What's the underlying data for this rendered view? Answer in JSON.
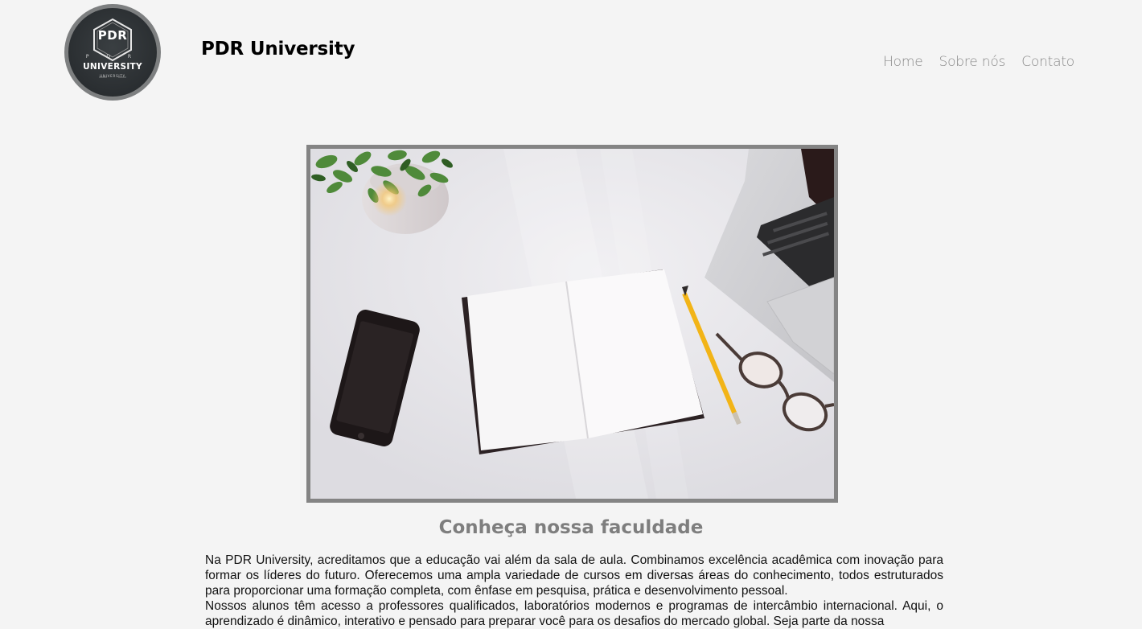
{
  "header": {
    "logo": {
      "icon": "university-logo",
      "monogram": "PDR",
      "letters": "P D R",
      "name": "UNIVERSITY",
      "tagline": "UNIVERSITY"
    },
    "site_title": "PDR University",
    "nav": [
      {
        "label": "Home"
      },
      {
        "label": "Sobre nós"
      },
      {
        "label": "Contato"
      }
    ]
  },
  "hero": {
    "alt": "Desk with notebook, phone, pencil, glasses, laptop and plant",
    "border_color": "#848484"
  },
  "main": {
    "section_title": "Conheça nossa faculdade",
    "paragraphs": [
      "Na PDR University, acreditamos que a educação vai além da sala de aula. Combinamos excelência acadêmica com inovação para formar os líderes do futuro. Oferecemos uma ampla variedade de cursos em diversas áreas do conhecimento, todos estruturados para proporcionar uma formação completa, com ênfase em pesquisa, prática e desenvolvimento pessoal.",
      "Nossos alunos têm acesso a professores qualificados, laboratórios modernos e programas de intercâmbio internacional. Aqui, o aprendizado é dinâmico, interativo e pensado para preparar você para os desafios do mercado global. Seja parte da nossa"
    ]
  },
  "colors": {
    "background": "#f4f4f4",
    "title_gray": "#7e7e7e",
    "nav_gray": "#8a8a8a"
  }
}
